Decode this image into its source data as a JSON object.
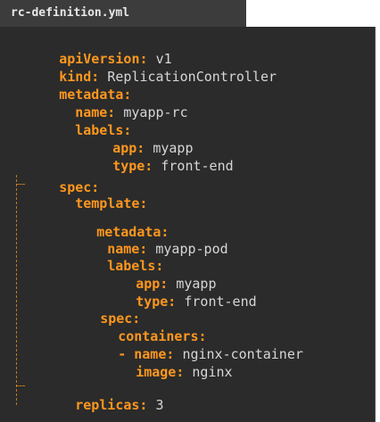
{
  "file": {
    "tab_title": "rc-definition.yml"
  },
  "yaml": {
    "apiVersion_key": "apiVersion:",
    "apiVersion_val": "v1",
    "kind_key": "kind:",
    "kind_val": "ReplicationController",
    "metadata_key": "metadata:",
    "meta_name_key": "name:",
    "meta_name_val": "myapp-rc",
    "meta_labels_key": "labels:",
    "meta_app_key": "app:",
    "meta_app_val": "myapp",
    "meta_type_key": "type:",
    "meta_type_val": "front-end",
    "spec_key": "spec:",
    "template_key": "template:",
    "tpl_metadata_key": "metadata:",
    "tpl_name_key": "name:",
    "tpl_name_val": "myapp-pod",
    "tpl_labels_key": "labels:",
    "tpl_app_key": "app:",
    "tpl_app_val": "myapp",
    "tpl_type_key": "type:",
    "tpl_type_val": "front-end",
    "tpl_spec_key": "spec:",
    "containers_key": "containers:",
    "container_dash": "-",
    "container_name_key": "name:",
    "container_name_val": "nginx-container",
    "container_image_key": "image:",
    "container_image_val": "nginx",
    "replicas_key": "replicas:",
    "replicas_val": "3"
  },
  "colors": {
    "key": "#fd971f",
    "value": "#d6d6d6",
    "editor_bg": "#2b2b2b",
    "tab_bg": "#3c3c3c"
  }
}
